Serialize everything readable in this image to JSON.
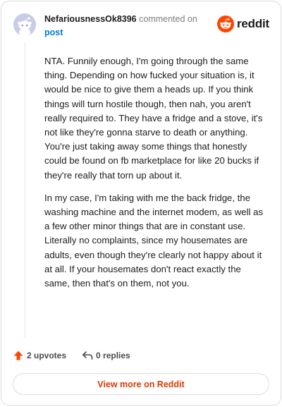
{
  "header": {
    "username": "NefariousnessOk8396",
    "action_text": "commented on",
    "target": "post"
  },
  "brand": {
    "wordmark": "reddit",
    "icon": "reddit-snoo-icon",
    "color": "#ff4500"
  },
  "comment": {
    "paragraphs": [
      "NTA. Funnily enough, I'm going through the same thing. Depending on how fucked your situation is, it would be nice to give them a heads up. If you think things will turn hostile though, then nah, you aren't really required to. They have a fridge and a stove, it's not like they're gonna starve to death or anything. You're just taking away some things that honestly could be found on fb marketplace for like 20 bucks if they're really that torn up about it.",
      "In my case, I'm taking with me the back fridge, the washing machine and the internet modem, as well as a few other minor things that are in constant use. Literally no complaints, since my housemates are adults, even though they're clearly not happy about it at all. If your housemates don't react exactly the same, then that's on them, not you."
    ]
  },
  "actions": {
    "upvotes_label": "2 upvotes",
    "upvote_icon": "upvote-arrow-icon",
    "upvote_color": "#ff4500",
    "replies_label": "0 replies",
    "reply_icon": "reply-arrow-icon"
  },
  "footer": {
    "view_more_label": "View more on Reddit",
    "accent_color": "#d93a00"
  }
}
